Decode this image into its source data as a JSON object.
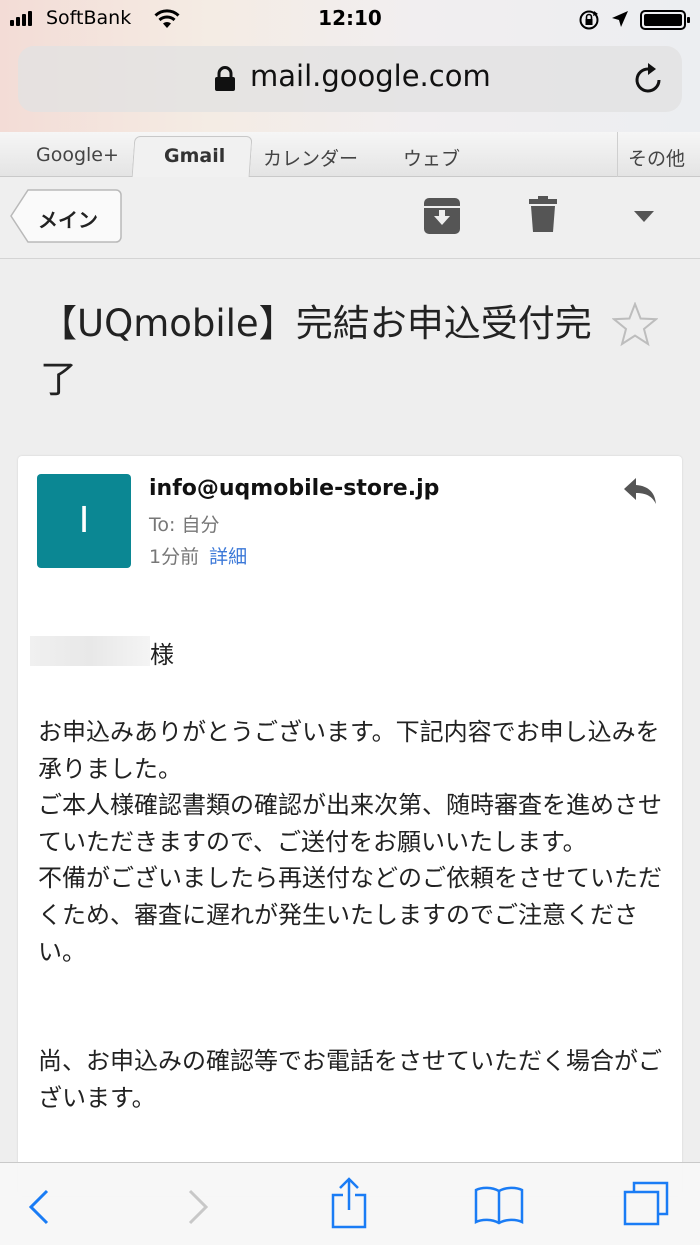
{
  "status_bar": {
    "carrier": "SoftBank",
    "time": "12:10"
  },
  "browser": {
    "url": "mail.google.com",
    "icons": [
      "lock-icon",
      "reload-icon"
    ]
  },
  "gmail_tabs": {
    "items": [
      "Google+",
      "Gmail",
      "カレンダー",
      "ウェブ"
    ],
    "more": "その他",
    "active": "Gmail"
  },
  "toolbar": {
    "back_label": "メイン",
    "icons": [
      "archive-icon",
      "trash-icon",
      "more-dropdown-icon"
    ]
  },
  "message": {
    "subject": "【UQmobile】完結お申込受付完了",
    "starred": false,
    "avatar_letter": "I",
    "avatar_color": "#0b8793",
    "sender": "info@uqmobile-store.jp",
    "to": "To: 自分",
    "time": "1分前",
    "details_link": "詳細",
    "salutation_suffix": "様",
    "paragraphs": [
      "お申込みありがとうございます。下記内容でお申し込みを承りました。",
      "ご本人様確認書類の確認が出来次第、随時審査を進めさせていただきますので、ご送付をお願いいたします。",
      "不備がございましたら再送付などのご依頼をさせていただくため、審査に遅れが発生いたしますのでご注意ください。",
      "尚、お申込みの確認等でお電話をさせていただく場合がございます。"
    ]
  },
  "bottom_bar": {
    "icons": [
      "back-arrow-icon",
      "forward-arrow-icon",
      "share-icon",
      "bookmarks-icon",
      "tabs-icon"
    ]
  },
  "colors": {
    "accent_blue": "#3b78d8",
    "safari_blue": "#1a7cf5"
  }
}
